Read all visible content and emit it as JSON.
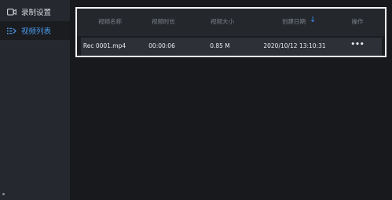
{
  "sidebar": {
    "items": [
      {
        "label": "录制设置",
        "icon": "video-camera-icon",
        "active": false
      },
      {
        "label": "视频列表",
        "icon": "list-icon",
        "active": true
      }
    ]
  },
  "table": {
    "columns": [
      "视频名称",
      "视频时长",
      "视频大小",
      "创建日期",
      "操作"
    ],
    "sort_indicator": "↓",
    "rows": [
      {
        "name": "Rec 0001.mp4",
        "duration": "00:00:06",
        "size": "0.85 M",
        "created": "2020/10/12 13:10:31",
        "actions": "•••"
      }
    ]
  },
  "colors": {
    "accent": "#4b9bec",
    "sidebar_bg": "#25282e",
    "app_bg": "#17191d",
    "highlight_border": "#f4f4f4"
  }
}
